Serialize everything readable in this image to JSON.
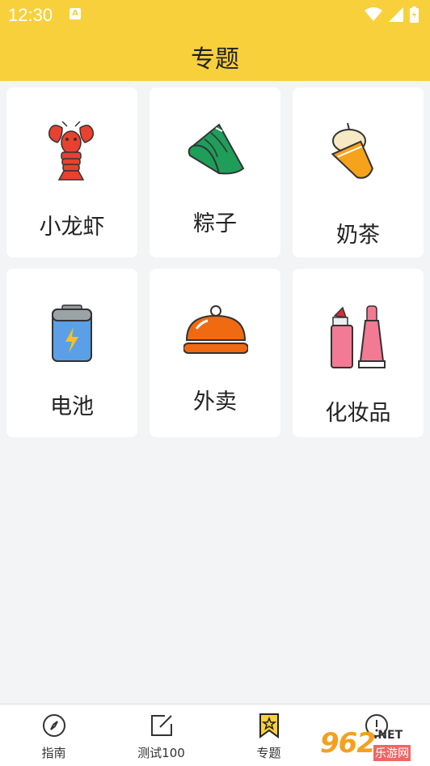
{
  "status_bar": {
    "time": "12:30",
    "notification_badge": "A"
  },
  "header": {
    "title": "专题"
  },
  "topics": [
    {
      "label": "小龙虾",
      "icon": "crayfish-icon"
    },
    {
      "label": "粽子",
      "icon": "zongzi-icon"
    },
    {
      "label": "奶茶",
      "icon": "milk-tea-icon"
    },
    {
      "label": "电池",
      "icon": "battery-icon"
    },
    {
      "label": "外卖",
      "icon": "food-cloche-icon"
    },
    {
      "label": "化妆品",
      "icon": "cosmetics-icon"
    }
  ],
  "bottom_nav": [
    {
      "label": "指南",
      "icon": "compass-icon"
    },
    {
      "label": "测试100",
      "icon": "edit-icon"
    },
    {
      "label": "专题",
      "icon": "bookmark-star-icon",
      "active": true
    },
    {
      "label": "",
      "icon": "info-icon"
    }
  ],
  "watermark": {
    "number": "962",
    "suffix": ".NET",
    "cn": "乐游网"
  }
}
